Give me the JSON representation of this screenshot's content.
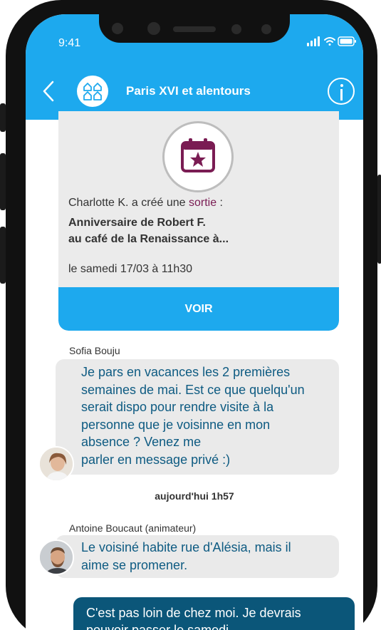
{
  "status_bar": {
    "time": "9:41"
  },
  "header": {
    "title": "Paris XVI et alentours"
  },
  "event_card": {
    "creator_prefix": "Charlotte K. a créé une ",
    "creator_keyword": "sortie",
    "creator_suffix": " :",
    "title_line1": "Anniversaire de Robert F.",
    "title_line2": "au café de la Renaissance à...",
    "date": "le samedi 17/03 à 11h30",
    "button_label": "VOIR"
  },
  "messages": [
    {
      "sender": "Sofia Bouju",
      "text": "Je pars en vacances les 2 premières\nsemaines de mai. Est ce que quelqu'un\nserait dispo pour rendre visite à la\npersonne que je voisinne en mon\nabsence ? Venez me\nparler en message privé :)"
    },
    {
      "sender": "Antoine Boucaut (animateur)",
      "text": "Le voisiné habite rue d'Alésia, mais il\naime se promener."
    }
  ],
  "date_separator": "aujourd'hui 1h57",
  "own_message": {
    "text": "C'est pas loin de chez moi. Je devrais\npouvoir passer le samedi"
  },
  "colors": {
    "primary": "#1da9ee",
    "own_bubble": "#0b5679",
    "bubble_text": "#0e5b82",
    "accent": "#7a1c53"
  }
}
